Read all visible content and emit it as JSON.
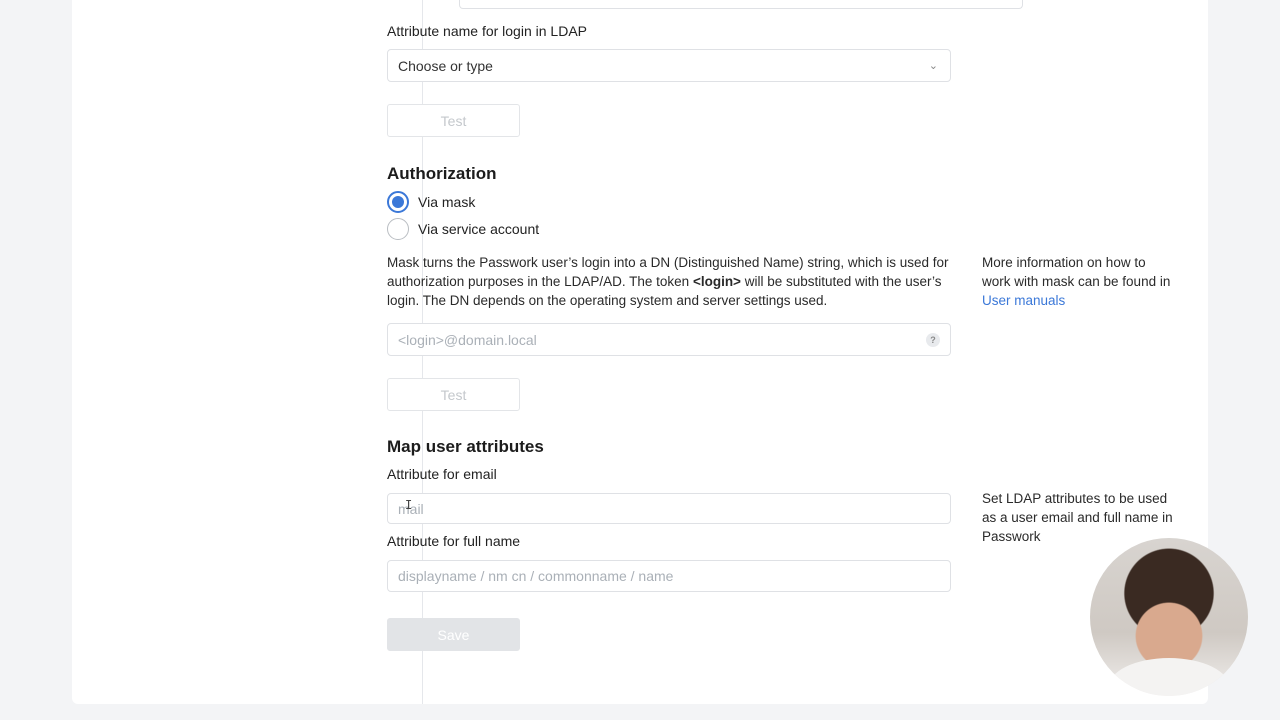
{
  "ldap_login": {
    "label": "Attribute name for login in LDAP",
    "select_value": "Choose or type",
    "test_button": "Test"
  },
  "authorization": {
    "title": "Authorization",
    "option_mask": "Via mask",
    "option_service": "Via service account",
    "description_part1": "Mask turns the Passwork user’s login into a DN (Distinguished Name) string, which is used for authorization purposes in the LDAP/AD. The token ",
    "description_token": "<login>",
    "description_part2": " will be substituted with the user’s login. The DN depends on the operating system and server settings used.",
    "info_text": "More information on how to work with mask can be found in ",
    "info_link": "User manuals",
    "mask_placeholder": "<login>@domain.local",
    "help_glyph": "?",
    "test_button": "Test"
  },
  "map_attributes": {
    "title": "Map user attributes",
    "email_label": "Attribute for email",
    "email_placeholder": "mail",
    "fullname_label": "Attribute for full name",
    "fullname_placeholder": "displayname / nm cn / commonname / name",
    "info_text": "Set LDAP attributes to be used as a user email and full name in Passwork",
    "save_button": "Save"
  },
  "colors": {
    "accent": "#3b78d8",
    "border": "#dfe1e5",
    "disabled_button_bg": "#e2e4e7"
  },
  "icons": {
    "select_chevron": "chevron-down-icon",
    "help": "question-circle-icon",
    "text_cursor": "text-cursor-icon"
  }
}
